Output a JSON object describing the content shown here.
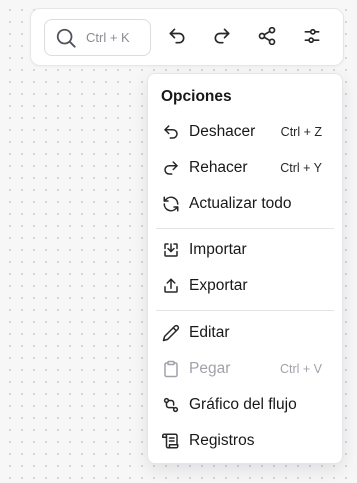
{
  "toolbar": {
    "search": {
      "shortcut": "Ctrl + K",
      "icon": "search-icon"
    },
    "buttons": [
      {
        "name": "undo",
        "icon": "undo-icon"
      },
      {
        "name": "redo",
        "icon": "redo-icon"
      },
      {
        "name": "share",
        "icon": "share-icon"
      },
      {
        "name": "settings",
        "icon": "sliders-icon"
      }
    ]
  },
  "menu": {
    "title": "Opciones",
    "items": [
      {
        "label": "Deshacer",
        "shortcut": "Ctrl + Z",
        "icon": "undo-icon",
        "enabled": true
      },
      {
        "label": "Rehacer",
        "shortcut": "Ctrl + Y",
        "icon": "redo-icon",
        "enabled": true
      },
      {
        "label": "Actualizar todo",
        "shortcut": "",
        "icon": "refresh-icon",
        "enabled": true
      },
      {
        "label": "Importar",
        "shortcut": "",
        "icon": "import-icon",
        "enabled": true
      },
      {
        "label": "Exportar",
        "shortcut": "",
        "icon": "export-icon",
        "enabled": true
      },
      {
        "label": "Editar",
        "shortcut": "",
        "icon": "pencil-icon",
        "enabled": true
      },
      {
        "label": "Pegar",
        "shortcut": "Ctrl + V",
        "icon": "clipboard-icon",
        "enabled": false
      },
      {
        "label": "Gráfico del flujo",
        "shortcut": "",
        "icon": "flow-graph-icon",
        "enabled": true
      },
      {
        "label": "Registros",
        "shortcut": "",
        "icon": "logs-icon",
        "enabled": true
      }
    ]
  },
  "colors": {
    "text": "#18181b",
    "disabled": "#a1a1aa",
    "border": "#e6e6e9",
    "canvas_dots": "#d4d4d8"
  }
}
